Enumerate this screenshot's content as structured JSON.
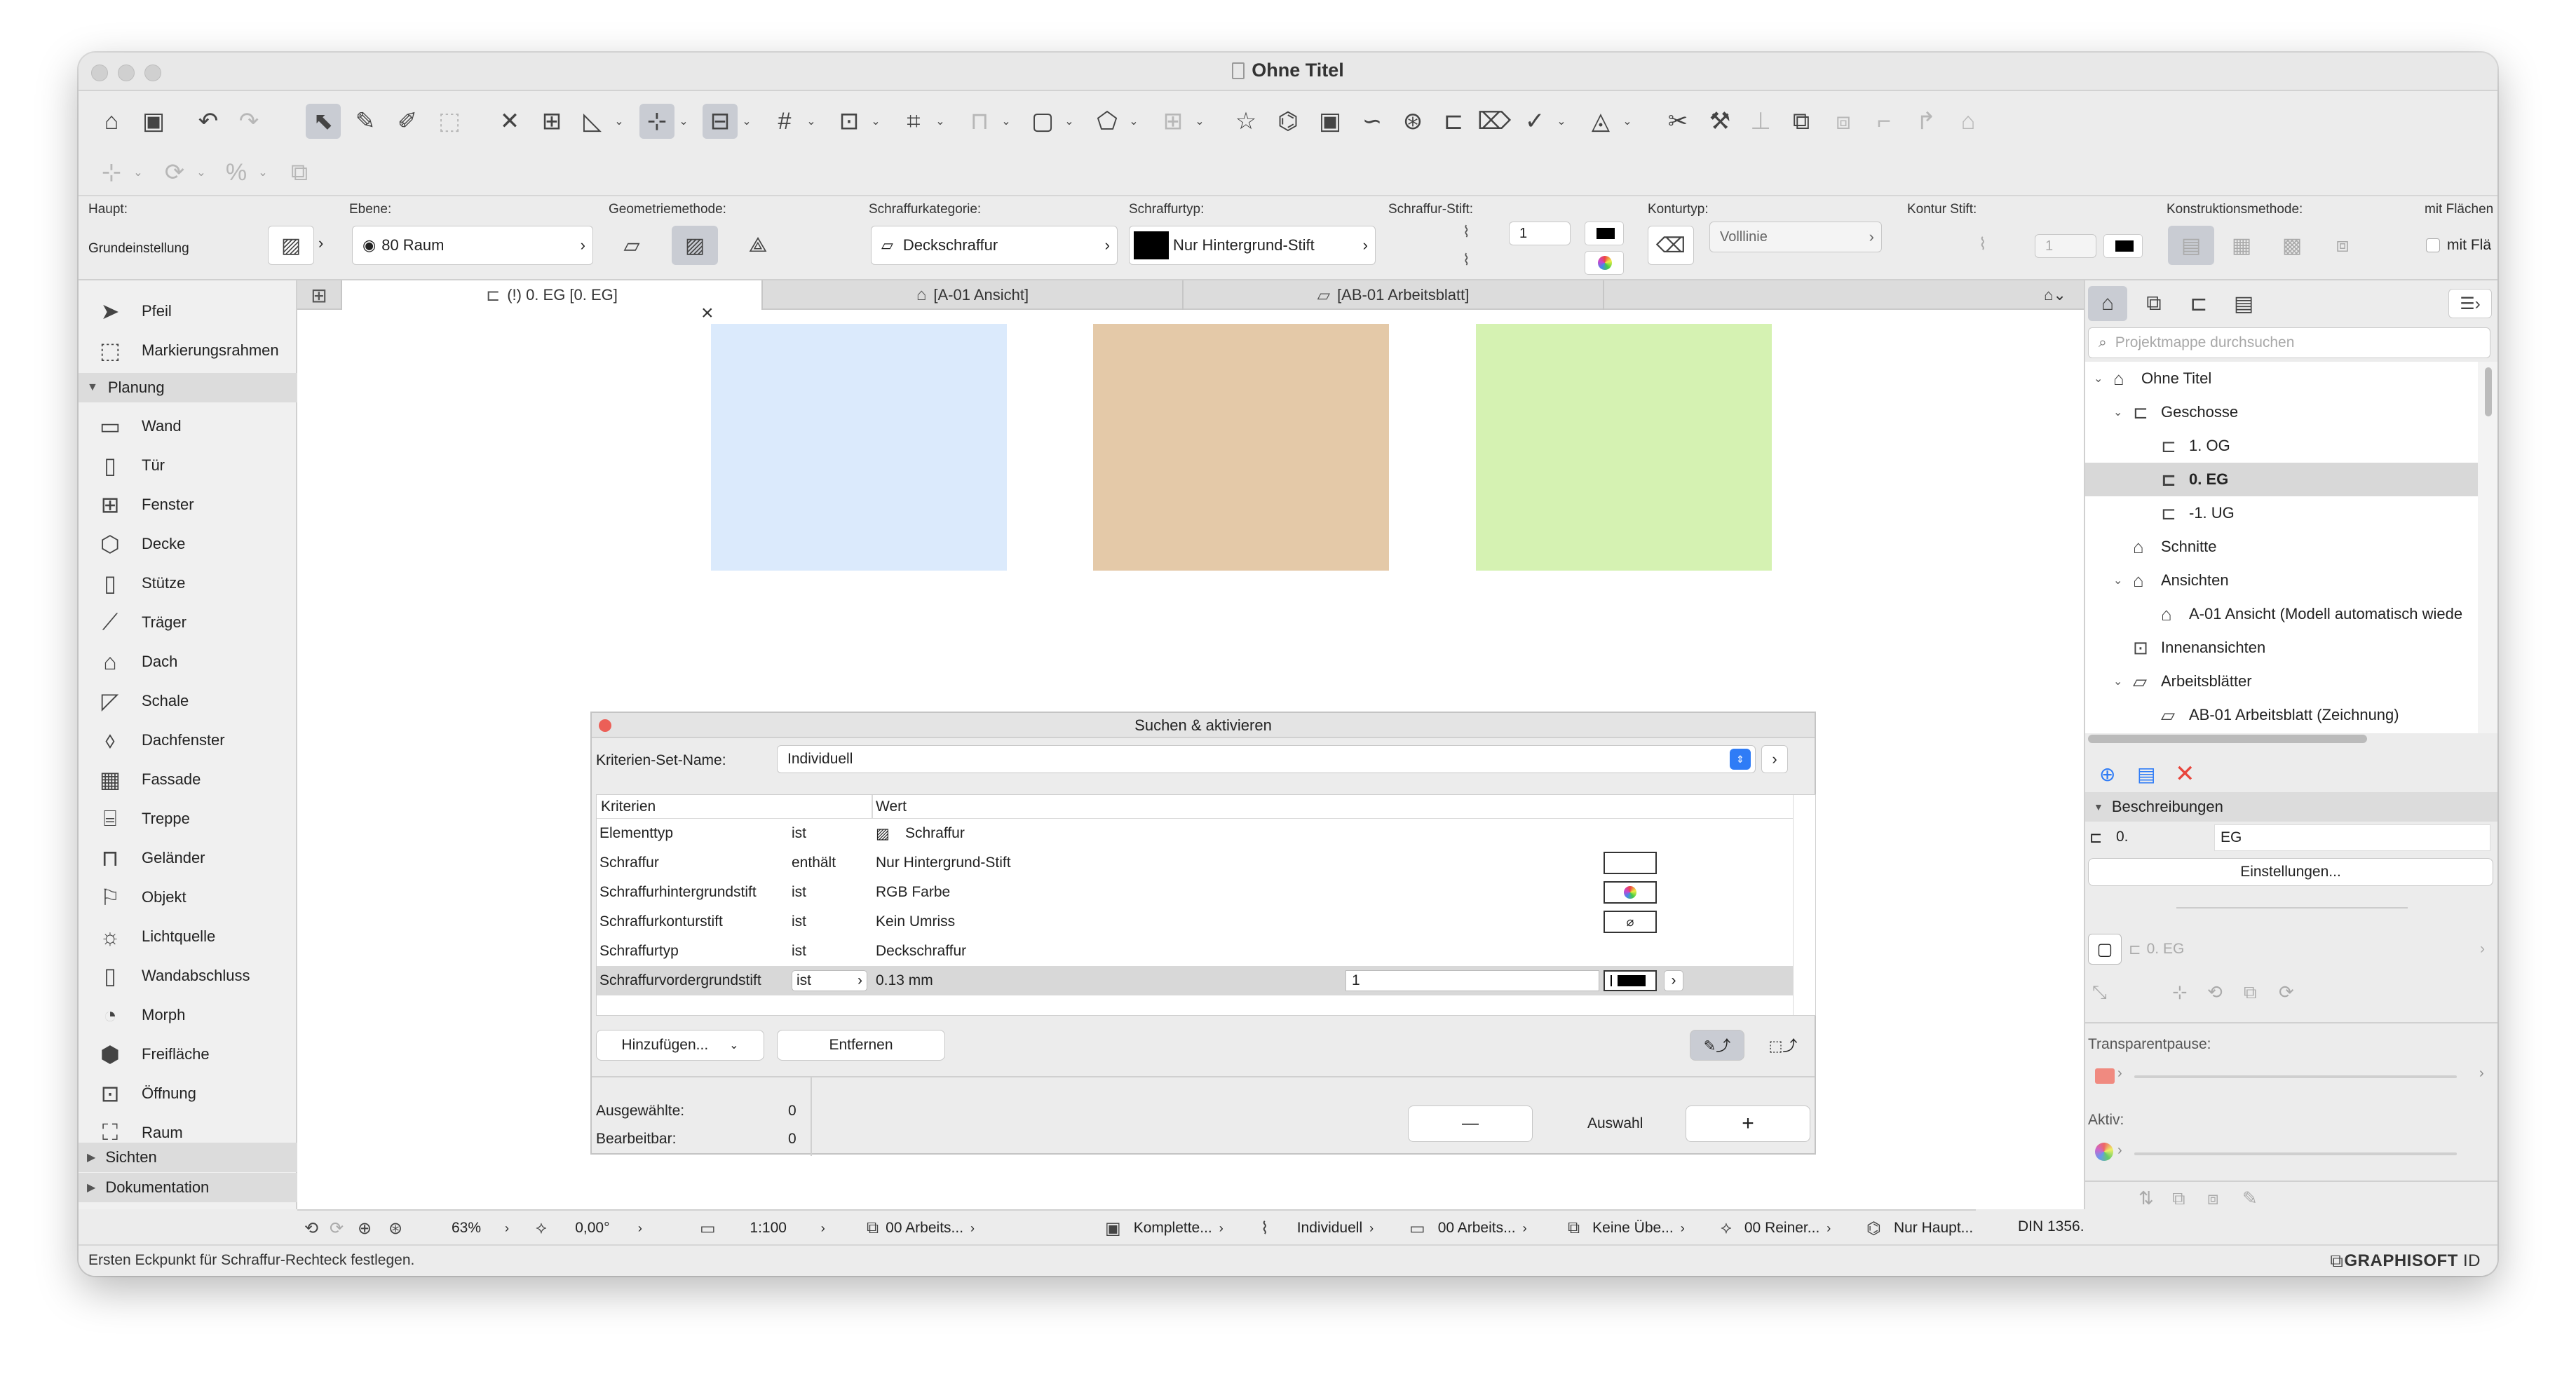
{
  "window": {
    "title": "Ohne Titel"
  },
  "icons": {
    "home": "⌂",
    "save": "🖫",
    "undo": "↶",
    "redo": "↷",
    "arrow": "➤",
    "eyedropper": "✎",
    "magic": "✦",
    "grid": "#",
    "star": "☆",
    "search": "⌕",
    "close_red": "✕",
    "plus_circle": "⊕",
    "list": "☰",
    "chevron_right": "›",
    "chevron_down": "⌄",
    "eye": "👁"
  },
  "infobox": {
    "haupt_label": "Haupt:",
    "grundeinstellung": "Grundeinstellung",
    "ebene_label": "Ebene:",
    "ebene_value": "80 Raum",
    "geometrie_label": "Geometriemethode:",
    "kategorie_label": "Schraffurkategorie:",
    "kategorie_value": "Deckschraffur",
    "typ_label": "Schraffurtyp:",
    "typ_value": "Nur Hintergrund-Stift",
    "stift_label": "Schraffur-Stift:",
    "stift_value": "1",
    "kontur_label": "Konturtyp:",
    "kontur_value": "Volllinie",
    "kontur_stift_label": "Kontur Stift:",
    "kontur_stift_value": "1",
    "konstruktion_label": "Konstruktionsmethode:",
    "flaechen_label": "mit Flächen",
    "flaechen_check": "mit Flä"
  },
  "toolbox": {
    "pointer": "Pfeil",
    "marquee": "Markierungsrahmen",
    "group_planung": "Planung",
    "tools": [
      "Wand",
      "Tür",
      "Fenster",
      "Decke",
      "Stütze",
      "Träger",
      "Dach",
      "Schale",
      "Dachfenster",
      "Fassade",
      "Treppe",
      "Geländer",
      "Objekt",
      "Lichtquelle",
      "Wandabschluss",
      "Morph",
      "Freifläche",
      "Öffnung",
      "Raum"
    ],
    "group_sichten": "Sichten",
    "group_dokumentation": "Dokumentation"
  },
  "tabs": [
    {
      "label": "(!) 0. EG [0. EG]"
    },
    {
      "label": "[A-01 Ansicht]"
    },
    {
      "label": "[AB-01 Arbeitsblatt]"
    }
  ],
  "canvas": {
    "marker": "×",
    "fill_colors": [
      "#dbeafc",
      "#e4c9a8",
      "#d5f2b2"
    ]
  },
  "dialog": {
    "title": "Suchen & aktivieren",
    "set_label": "Kriterien-Set-Name:",
    "set_value": "Individuell",
    "col_criteria": "Kriterien",
    "col_value": "Wert",
    "rows": [
      {
        "criterion": "Elementtyp",
        "op": "ist",
        "value": "Schraffur",
        "swatch": ""
      },
      {
        "criterion": "Schraffur",
        "op": "enthält",
        "value": "Nur Hintergrund-Stift",
        "swatch": "blank"
      },
      {
        "criterion": "Schraffurhintergrundstift",
        "op": "ist",
        "value": "RGB Farbe",
        "swatch": "rgb"
      },
      {
        "criterion": "Schraffurkonturstift",
        "op": "ist",
        "value": "Kein Umriss",
        "swatch": "none"
      },
      {
        "criterion": "Schraffurtyp",
        "op": "ist",
        "value": "Deckschraffur",
        "swatch": ""
      },
      {
        "criterion": "Schraffurvordergrundstift",
        "op": "ist",
        "value": "0.13 mm",
        "pen": "1",
        "swatch": "pen"
      }
    ],
    "add_button": "Hinzufügen...",
    "remove_button": "Entfernen",
    "selected_label": "Ausgewählte:",
    "selected_value": "0",
    "editable_label": "Bearbeitbar:",
    "editable_value": "0",
    "minus": "—",
    "selection_label": "Auswahl",
    "plus": "+"
  },
  "navigator": {
    "search_placeholder": "Projektmappe durchsuchen",
    "tree": [
      {
        "label": "Ohne Titel",
        "level": 0,
        "expanded": true
      },
      {
        "label": "Geschosse",
        "level": 1,
        "expanded": true
      },
      {
        "label": "1. OG",
        "level": 2
      },
      {
        "label": "0. EG",
        "level": 2,
        "selected": true
      },
      {
        "label": "-1. UG",
        "level": 2
      },
      {
        "label": "Schnitte",
        "level": 1
      },
      {
        "label": "Ansichten",
        "level": 1,
        "expanded": true
      },
      {
        "label": "A-01 Ansicht (Modell automatisch wiede",
        "level": 2
      },
      {
        "label": "Innenansichten",
        "level": 1
      },
      {
        "label": "Arbeitsblätter",
        "level": 1,
        "expanded": true
      },
      {
        "label": "AB-01 Arbeitsblatt (Zeichnung)",
        "level": 2
      }
    ],
    "beschreibungen": "Beschreibungen",
    "desc_num": "0.",
    "desc_name": "EG",
    "settings_button": "Einstellungen...",
    "view_label": "0. EG",
    "transparent_label": "Transparentpause:",
    "active_label": "Aktiv:"
  },
  "zoombar": {
    "zoom": "63%",
    "angle": "0,00°",
    "scale": "1:100",
    "layers": "00 Arbeits...",
    "model": "Komplette...",
    "pen": "Individuell",
    "graphic": "00 Arbeits...",
    "override": "Keine Übe...",
    "renovation": "00 Reiner...",
    "structure": "Nur Haupt...",
    "dimension": "DIN 1356..."
  },
  "status": {
    "text": "Ersten Eckpunkt für Schraffur-Rechteck festlegen.",
    "logo_a": "GRAPHISOFT",
    "logo_b": "ID"
  }
}
